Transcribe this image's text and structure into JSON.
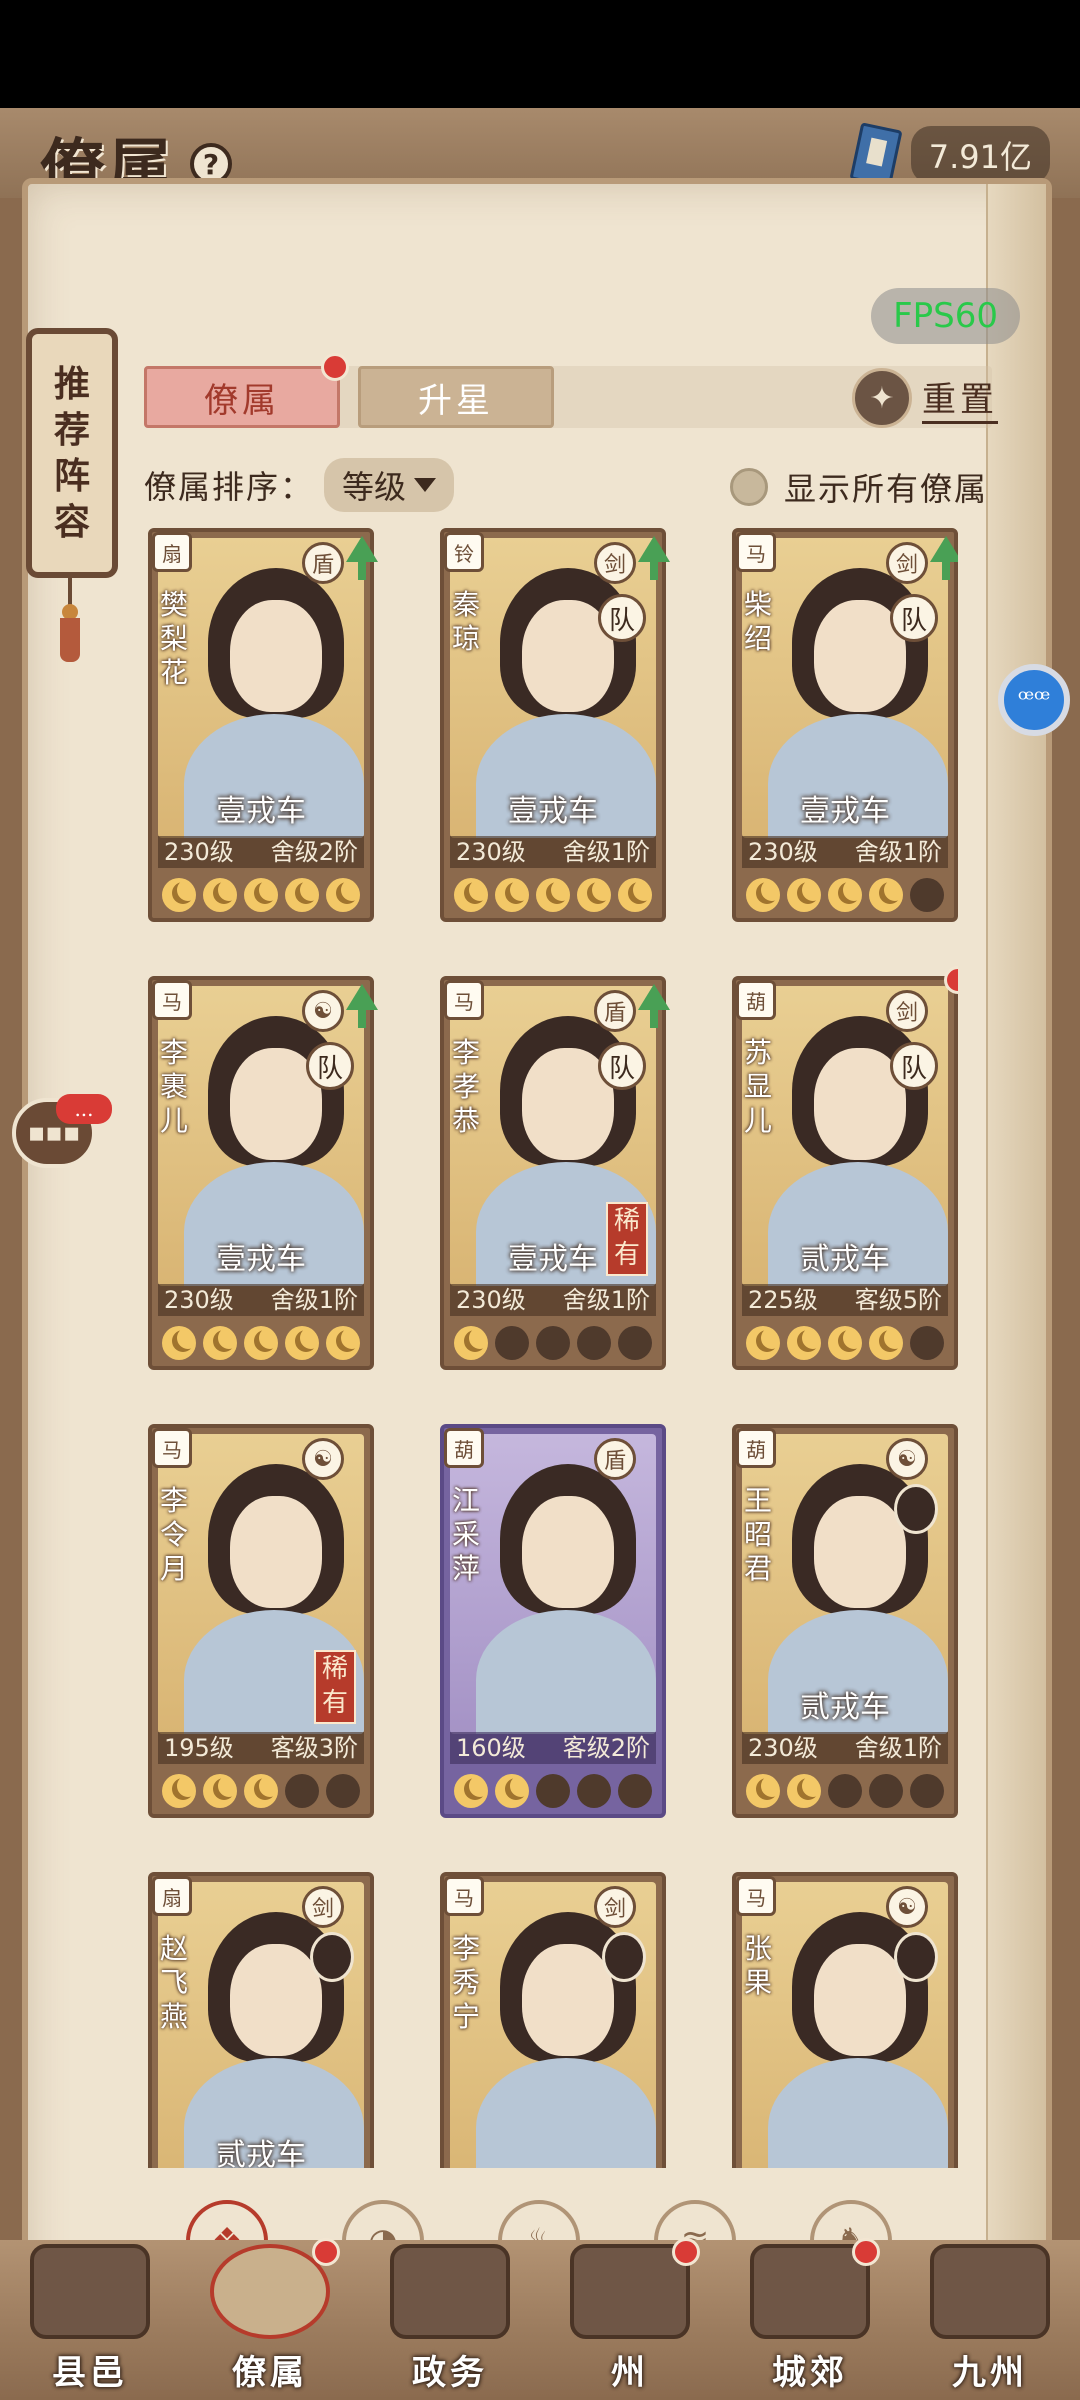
{
  "header": {
    "title": "僚属",
    "help_icon": "?",
    "currency_icon": "book-icon",
    "currency_value": "7.91亿",
    "fps": "FPS60"
  },
  "side_scroll": {
    "lines": [
      "推",
      "荐",
      "阵",
      "容"
    ]
  },
  "tabs": [
    {
      "label": "僚属",
      "active": true,
      "badge": true
    },
    {
      "label": "升星",
      "active": false,
      "badge": false
    }
  ],
  "reset": {
    "icon": "reset-icon",
    "label": "重置"
  },
  "sort": {
    "label": "僚属排序：",
    "value": "等级"
  },
  "show_all": {
    "label": "显示所有僚属",
    "checked": false
  },
  "cards": [
    {
      "name": "樊梨花",
      "vehicle": "壹戎车",
      "level": "230级",
      "rank": "舍级2阶",
      "stars": 5,
      "emblem": "fan",
      "class_icon": "shield",
      "upgrade": true,
      "team": "",
      "rare": "",
      "avatar": false,
      "reddot": false,
      "purple": false
    },
    {
      "name": "秦琼",
      "vehicle": "壹戎车",
      "level": "230级",
      "rank": "舍级1阶",
      "stars": 5,
      "emblem": "bell",
      "class_icon": "sword",
      "upgrade": true,
      "team": "队",
      "rare": "",
      "avatar": false,
      "reddot": false,
      "purple": false
    },
    {
      "name": "柴绍",
      "vehicle": "壹戎车",
      "level": "230级",
      "rank": "舍级1阶",
      "stars": 4,
      "emblem": "horse",
      "class_icon": "sword",
      "upgrade": true,
      "team": "队",
      "rare": "",
      "avatar": false,
      "reddot": false,
      "purple": false
    },
    {
      "name": "李裹儿",
      "vehicle": "壹戎车",
      "level": "230级",
      "rank": "舍级1阶",
      "stars": 5,
      "emblem": "horse",
      "class_icon": "yin-yang",
      "upgrade": true,
      "team": "队",
      "rare": "",
      "avatar": false,
      "reddot": false,
      "purple": false
    },
    {
      "name": "李孝恭",
      "vehicle": "壹戎车",
      "level": "230级",
      "rank": "舍级1阶",
      "stars": 1,
      "emblem": "horse",
      "class_icon": "shield",
      "upgrade": true,
      "team": "队",
      "rare": "稀有",
      "avatar": false,
      "reddot": false,
      "purple": false
    },
    {
      "name": "苏显儿",
      "vehicle": "贰戎车",
      "level": "225级",
      "rank": "客级5阶",
      "stars": 4,
      "emblem": "gourd",
      "class_icon": "sword",
      "upgrade": false,
      "team": "队",
      "rare": "",
      "avatar": false,
      "reddot": true,
      "purple": false
    },
    {
      "name": "李令月",
      "vehicle": "",
      "level": "195级",
      "rank": "客级3阶",
      "stars": 3,
      "emblem": "horse",
      "class_icon": "yin-yang",
      "upgrade": false,
      "team": "",
      "rare": "稀有",
      "avatar": false,
      "reddot": false,
      "purple": false
    },
    {
      "name": "江采萍",
      "vehicle": "",
      "level": "160级",
      "rank": "客级2阶",
      "stars": 2,
      "emblem": "gourd",
      "class_icon": "shield",
      "upgrade": false,
      "team": "",
      "rare": "",
      "avatar": false,
      "reddot": false,
      "purple": true
    },
    {
      "name": "王昭君",
      "vehicle": "贰戎车",
      "level": "230级",
      "rank": "舍级1阶",
      "stars": 2,
      "emblem": "gourd",
      "class_icon": "yin-yang",
      "upgrade": false,
      "team": "",
      "rare": "",
      "avatar": true,
      "reddot": false,
      "purple": false
    },
    {
      "name": "赵飞燕",
      "vehicle": "贰戎车",
      "level": "",
      "rank": "",
      "stars": -1,
      "emblem": "fan",
      "class_icon": "sword",
      "upgrade": false,
      "team": "",
      "rare": "",
      "avatar": true,
      "reddot": false,
      "purple": false
    },
    {
      "name": "李秀宁",
      "vehicle": "",
      "level": "",
      "rank": "",
      "stars": -1,
      "emblem": "horse",
      "class_icon": "sword",
      "upgrade": false,
      "team": "",
      "rare": "",
      "avatar": true,
      "reddot": false,
      "purple": false
    },
    {
      "name": "张果",
      "vehicle": "",
      "level": "",
      "rank": "",
      "stars": -1,
      "emblem": "horse",
      "class_icon": "yin-yang",
      "upgrade": false,
      "team": "",
      "rare": "",
      "avatar": true,
      "reddot": false,
      "purple": false
    }
  ],
  "filters": [
    {
      "icon": "all-diamond-icon",
      "active": true
    },
    {
      "icon": "bell-icon",
      "active": false
    },
    {
      "icon": "gourd-icon",
      "active": false
    },
    {
      "icon": "fan-icon",
      "active": false
    },
    {
      "icon": "horse-icon",
      "active": false
    }
  ],
  "nav": [
    {
      "label": "县邑",
      "badge": false,
      "selected": false
    },
    {
      "label": "僚属",
      "badge": true,
      "selected": true
    },
    {
      "label": "政务",
      "badge": false,
      "selected": false
    },
    {
      "label": "州",
      "badge": true,
      "selected": false
    },
    {
      "label": "城郊",
      "badge": true,
      "selected": false
    },
    {
      "label": "九州",
      "badge": false,
      "selected": false
    }
  ],
  "float_button": {
    "icon": "assist-icon"
  },
  "chat": {
    "icon": "chat-icon",
    "badge_text": "..."
  }
}
